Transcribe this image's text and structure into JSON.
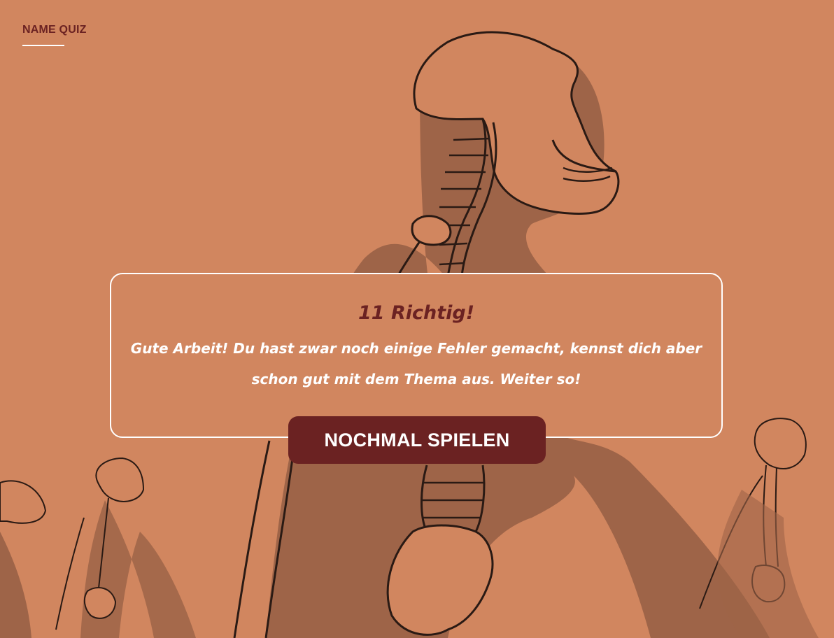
{
  "app": {
    "brand": "NAME QUIZ"
  },
  "result": {
    "title": "11 Richtig!",
    "message": "Gute Arbeit! Du hast zwar noch einige Fehler gemacht, kennst dich aber schon gut mit dem Thema aus. Weiter so!"
  },
  "actions": {
    "replay_label": "NOCHMAL SPIELEN"
  },
  "theme": {
    "background": "#d1865f",
    "shadow": "#9e6448",
    "accent": "#6b2222",
    "text_light": "#ffffff",
    "bone": "#d1865f",
    "outline": "#2a1a14"
  },
  "illustration": {
    "subject": "skeleton-evolution-illustration"
  }
}
